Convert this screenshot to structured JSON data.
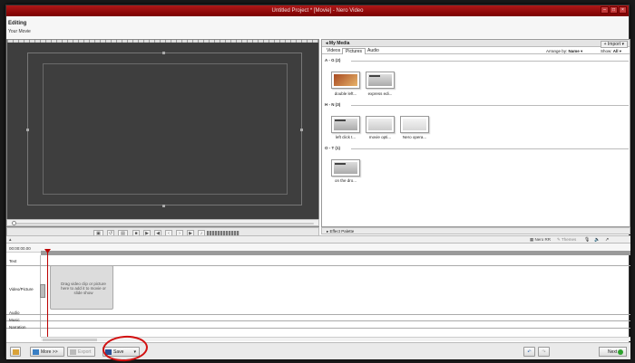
{
  "window": {
    "title": "Untitled Project * [Movie] - Nero Video"
  },
  "header": {
    "mode": "Editing",
    "subtitle": "Your Movie"
  },
  "media": {
    "title": "My Media",
    "import_label": "Import",
    "tabs": [
      "Videos",
      "Pictures",
      "Audio"
    ],
    "active_tab": 1,
    "arrange_label": "Arrange by:",
    "arrange_value": "Name",
    "show_label": "Show:",
    "show_value": "All",
    "groups": [
      {
        "label": "A - G (2)",
        "items": [
          "double left...",
          "express edi..."
        ]
      },
      {
        "label": "H - N (3)",
        "items": [
          "left click t...",
          "movie opti...",
          "Nero opera..."
        ]
      },
      {
        "label": "O - T (1)",
        "items": [
          "on the dro..."
        ]
      }
    ]
  },
  "effects": {
    "label": "Effect Palette"
  },
  "timeline_toolbar": {
    "nero_rr": "Nero RR",
    "themes": "Themes"
  },
  "timeline": {
    "timecode": "00:00:00.00",
    "tracks": [
      "Text",
      "Video/Picture",
      "Audio",
      "Music",
      "Narration"
    ],
    "drop_hint": "Drag video clip or picture here to add it to movie or slide show"
  },
  "bottom": {
    "more_label": "More >>",
    "export_label": "Export",
    "save_label": "Save",
    "next_label": "Next"
  }
}
